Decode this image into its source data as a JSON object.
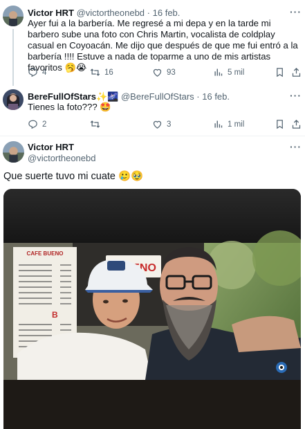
{
  "tweets": [
    {
      "name": "Victor HRT",
      "handle": "@victortheonebd",
      "dot": "·",
      "date": "16 feb.",
      "text": "Ayer fui a la barbería. Me regresé a mi depa y en la tarde mi barbero sube una foto con Chris Martin, vocalista de coldplay casual en Coyoacán. Me dijo que después de que me fui entró a la barbería !!!! Estuve a nada de toparme a uno de mis artistas favoritos 🥱😭",
      "actions": {
        "replies": "4",
        "retweets": "16",
        "likes": "93",
        "views": "5 mil"
      }
    },
    {
      "name": "BereFullOfStars✨🌌",
      "handle": "@BereFullOfStars",
      "dot": "·",
      "date": "16 feb.",
      "text": "Tienes la foto??? 🤩",
      "actions": {
        "replies": "2",
        "retweets": "",
        "likes": "3",
        "views": "1 mil"
      }
    },
    {
      "name": "Victor HRT",
      "handle": "@victortheonebd",
      "text": "Que suerte tuvo mi cuate 🥲🥹"
    }
  ],
  "more_label": "···",
  "photo": {
    "menu_title": "CAFE BUENO",
    "sign_text": "BUENO",
    "menu_letter": "B"
  },
  "colors": {
    "text": "#0f1419",
    "secondary": "#536471",
    "divider": "#eff3f4"
  },
  "icons": [
    "reply-icon",
    "retweet-icon",
    "like-icon",
    "views-icon",
    "bookmark-icon",
    "share-icon",
    "more-icon"
  ]
}
